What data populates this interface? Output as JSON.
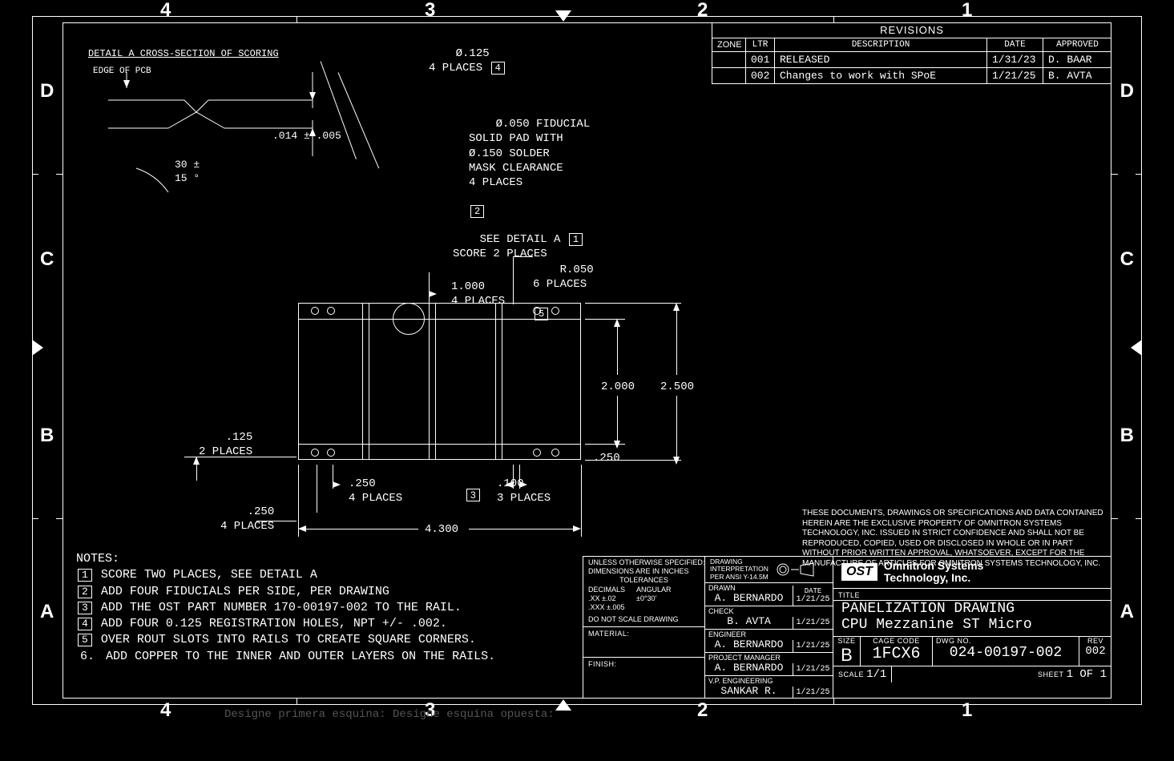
{
  "border": {
    "letters": [
      "D",
      "C",
      "B",
      "A"
    ],
    "numbers": [
      "4",
      "3",
      "2",
      "1"
    ]
  },
  "revisions": {
    "title": "REVISIONS",
    "headers": {
      "zone": "ZONE",
      "ltr": "LTR",
      "desc": "DESCRIPTION",
      "date": "DATE",
      "appr": "APPROVED"
    },
    "rows": [
      {
        "zone": "",
        "ltr": "001",
        "desc": "RELEASED",
        "date": "1/31/23",
        "appr": "D. BAAR"
      },
      {
        "zone": "",
        "ltr": "002",
        "desc": "Changes to work with SPoE",
        "date": "1/21/25",
        "appr": "B. AVTA"
      }
    ]
  },
  "detail_a": {
    "title": "DETAIL A CROSS-SECTION OF SCORING",
    "edge_label": "EDGE OF PCB",
    "dim1": ".014 ± .005",
    "dim2": "30 ±\n15 °"
  },
  "callouts": {
    "c1": "Ø.125\n4 PLACES",
    "c1_tag": "4",
    "c2": "Ø.050 FIDUCIAL\nSOLID PAD WITH\nØ.150 SOLDER\nMASK CLEARANCE\n4 PLACES",
    "c2_tag": "2",
    "c3": "SEE DETAIL A",
    "c3b": "SCORE 2 PLACES",
    "c3_tag": "1",
    "c4": "R.050\n6 PLACES",
    "c4_tag": "5",
    "c5": "1.000\n4 PLACES",
    "c6": ".125\n2 PLACES",
    "c7": ".250\n4 PLACES",
    "c7b": ".250\n4 PLACES",
    "c8": ".100\n3 PLACES",
    "c9_tag": "3",
    "len": "4.300",
    "h1": "2.000",
    "h2": "2.500",
    "h3": ".250"
  },
  "notes": {
    "title": "NOTES:",
    "items": [
      {
        "num": "1",
        "boxed": true,
        "text": "SCORE TWO PLACES, SEE DETAIL A"
      },
      {
        "num": "2",
        "boxed": true,
        "text": "ADD FOUR FIDUCIALS PER SIDE, PER DRAWING"
      },
      {
        "num": "3",
        "boxed": true,
        "text": "ADD THE OST PART NUMBER 170-00197-002 TO THE RAIL."
      },
      {
        "num": "4",
        "boxed": true,
        "text": "ADD FOUR 0.125 REGISTRATION HOLES, NPT +/- .002."
      },
      {
        "num": "5",
        "boxed": true,
        "text": "OVER ROUT SLOTS INTO RAILS TO CREATE SQUARE CORNERS."
      },
      {
        "num": "6.",
        "boxed": false,
        "text": "ADD COPPER TO THE INNER AND OUTER LAYERS ON THE RAILS."
      }
    ]
  },
  "ip_text": "THESE DOCUMENTS, DRAWINGS OR SPECIFICATIONS AND DATA CONTAINED\nHEREIN ARE THE EXCLUSIVE PROPERTY OF OMNITRON SYSTEMS\nTECHNOLOGY, INC. ISSUED IN STRICT CONFIDENCE AND SHALL NOT BE\nREPRODUCED, COPIED, USED OR DISCLOSED IN WHOLE OR IN PART WITHOUT\nPRIOR WRITTEN APPROVAL, WHATSOEVER, EXCEPT FOR THE MANUFACTURE\nOF ARTICLES FOR OMNITRON SYSTEMS TECHNOLOGY, INC.",
  "title_block": {
    "tol": {
      "l1": "UNLESS OTHERWISE SPECIFIED:",
      "l2": "DIMENSIONS ARE IN INCHES",
      "l3": "TOLERANCES",
      "l4a": "DECIMALS",
      "l4b": "ANGULAR",
      "l5a": ".XX ±.02",
      "l5b": "±0°30'",
      "l6": ".XXX ±.005",
      "l7": "DO NOT SCALE DRAWING"
    },
    "interp": "DRAWING\nINTERPRETATION\nPER ANSI Y-14.5M",
    "sig_labels": {
      "drawn": "DRAWN",
      "check": "CHECK",
      "eng": "ENGINEER",
      "pm": "PROJECT MANAGER",
      "vpe": "V.P. ENGINEERING",
      "date": "DATE"
    },
    "drawn": {
      "name": "A. BERNARDO",
      "date": "1/21/25"
    },
    "check": {
      "name": "B. AVTA",
      "date": "1/21/25"
    },
    "eng": {
      "name": "A. BERNARDO",
      "date": "1/21/25"
    },
    "pm": {
      "name": "A. BERNARDO",
      "date": "1/21/25"
    },
    "vpe": {
      "name": "SANKAR R.",
      "date": "1/21/25"
    },
    "material_lbl": "MATERIAL:",
    "finish_lbl": "FINISH:",
    "company": {
      "mark": "OST",
      "line1": "Omnitron Systems",
      "line2": "Technology, Inc."
    },
    "title_lbl": "TITLE",
    "title1": "PANELIZATION DRAWING",
    "title2": "CPU Mezzanine ST Micro",
    "size_lbl": "SIZE",
    "size": "B",
    "cage_lbl": "CAGE CODE",
    "cage": "1FCX6",
    "dwgno_lbl": "DWG NO.",
    "dwgno": "024-00197-002",
    "rev_lbl": "REV",
    "rev": "002",
    "scale_lbl": "SCALE",
    "scale": "1/1",
    "sheet_lbl": "SHEET",
    "sheet": "1 OF 1"
  },
  "command_line": "Designe primera esquina: Designe esquina opuesta:"
}
